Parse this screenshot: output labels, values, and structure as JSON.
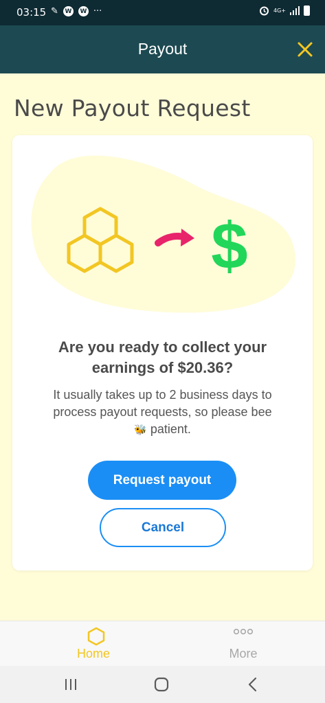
{
  "status_bar": {
    "time": "03:15",
    "left_icons": [
      "ink-icon",
      "w-app-icon",
      "w-app-icon",
      "more-dots-icon"
    ],
    "w_badge": "W",
    "more_dots": "···",
    "network": "4G+",
    "right_icons": [
      "alarm-icon",
      "network-4g-icon",
      "signal-icon",
      "battery-icon"
    ]
  },
  "app_bar": {
    "title": "Payout",
    "close_icon": "close-icon",
    "accent": "#f2c623"
  },
  "page": {
    "title": "New Payout Request"
  },
  "card": {
    "illustration_icons": [
      "honeycomb-icon",
      "arrow-icon",
      "dollar-icon"
    ],
    "dollar_symbol": "$",
    "question": "Are you ready to collect your earnings of $20.36?",
    "body_text": "It usually takes up to 2 business days to process payout requests, so please bee",
    "body_text_end": "patient.",
    "bee_emoji": "🐝",
    "primary_button": "Request payout",
    "secondary_button": "Cancel"
  },
  "bottom_nav": {
    "items": [
      {
        "label": "Home",
        "icon": "hexagon-icon",
        "active": true
      },
      {
        "label": "More",
        "icon": "more-circles-icon",
        "active": false
      }
    ]
  },
  "system_nav": {
    "buttons": [
      "recent-apps-icon",
      "home-circle-icon",
      "back-chevron-icon"
    ]
  },
  "colors": {
    "status_bar": "#0e2a33",
    "app_bar": "#1d4a52",
    "background": "#fffcd8",
    "primary": "#1a8ef5",
    "honey": "#f2c623",
    "arrow": "#e8246b",
    "dollar": "#22d65a"
  }
}
